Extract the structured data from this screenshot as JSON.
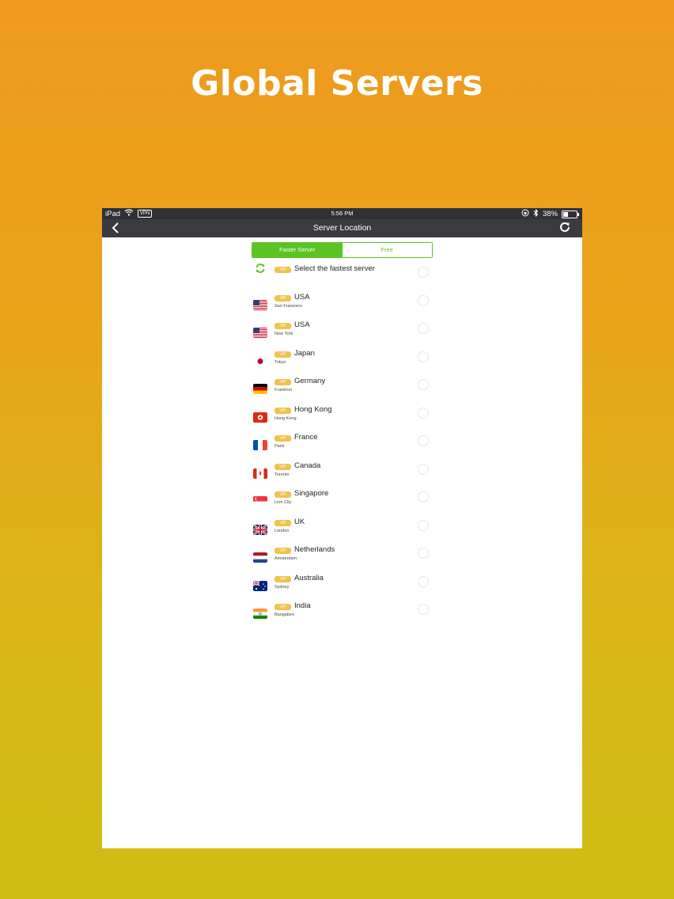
{
  "headline": "Global Servers",
  "status_bar": {
    "device": "iPad",
    "vpn": "VPN",
    "time": "5:56 PM",
    "battery": "38%",
    "battery_level": 0.38
  },
  "nav": {
    "title": "Server Location",
    "back_icon": "chevron-left-icon",
    "refresh_icon": "refresh-icon"
  },
  "segments": [
    "Faster Server",
    "Free"
  ],
  "active_segment": 0,
  "vip_label": "VIP",
  "fastest": {
    "label": "Select the fastest server"
  },
  "servers": [
    {
      "country": "USA",
      "city": "San Francisco",
      "flag": "us"
    },
    {
      "country": "USA",
      "city": "New York",
      "flag": "us"
    },
    {
      "country": "Japan",
      "city": "Tokyo",
      "flag": "jp"
    },
    {
      "country": "Germany",
      "city": "Frankfurt",
      "flag": "de"
    },
    {
      "country": "Hong Kong",
      "city": "Hong Kong",
      "flag": "hk"
    },
    {
      "country": "France",
      "city": "Paris",
      "flag": "fr"
    },
    {
      "country": "Canada",
      "city": "Toronto",
      "flag": "ca"
    },
    {
      "country": "Singapore",
      "city": "Lion City",
      "flag": "sg"
    },
    {
      "country": "UK",
      "city": "London",
      "flag": "gb"
    },
    {
      "country": "Netherlands",
      "city": "Amsterdam",
      "flag": "nl"
    },
    {
      "country": "Australia",
      "city": "Sydney",
      "flag": "au"
    },
    {
      "country": "India",
      "city": "Bangalore",
      "flag": "in"
    }
  ],
  "colors": {
    "accent_green": "#5bc424",
    "vip_gold": "#f2c14e",
    "bar_dark": "#3a3b40"
  }
}
